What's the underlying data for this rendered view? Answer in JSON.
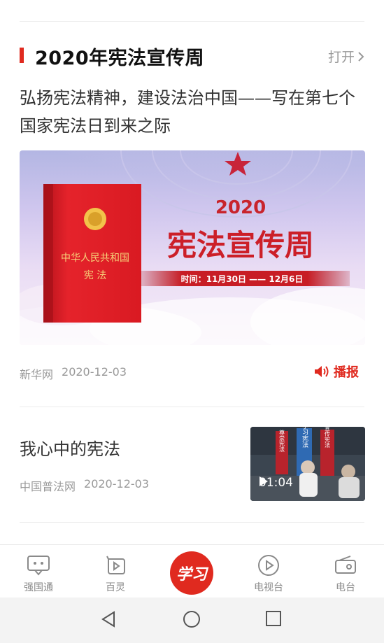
{
  "section": {
    "title": "2020年宪法宣传周",
    "open_label": "打开"
  },
  "article1": {
    "headline": "弘扬宪法精神，建设法治中国——写在第七个国家宪法日到来之际",
    "banner": {
      "year": "2020",
      "title": "宪法宣传周",
      "date_text": "时间：11月30日 —— 12月6日",
      "book_title": "中华人民共和国",
      "book_subtitle": "宪 法"
    },
    "source": "新华网",
    "date": "2020-12-03",
    "broadcast_label": "播报"
  },
  "article2": {
    "title": "我心中的宪法",
    "source": "中国普法网",
    "date": "2020-12-03",
    "duration": "01:04",
    "thumb_banners": [
      "尊崇宪法",
      "学习宪法",
      "宣传宪法"
    ]
  },
  "tabbar": {
    "items": [
      {
        "label": "强国通",
        "icon": "chat-icon"
      },
      {
        "label": "百灵",
        "icon": "video-play-icon"
      },
      {
        "label": "学习",
        "icon": "xuexi-logo"
      },
      {
        "label": "电视台",
        "icon": "play-circle-icon"
      },
      {
        "label": "电台",
        "icon": "radio-icon"
      }
    ]
  },
  "colors": {
    "accent_red": "#e02a1f",
    "muted_text": "#999999"
  }
}
